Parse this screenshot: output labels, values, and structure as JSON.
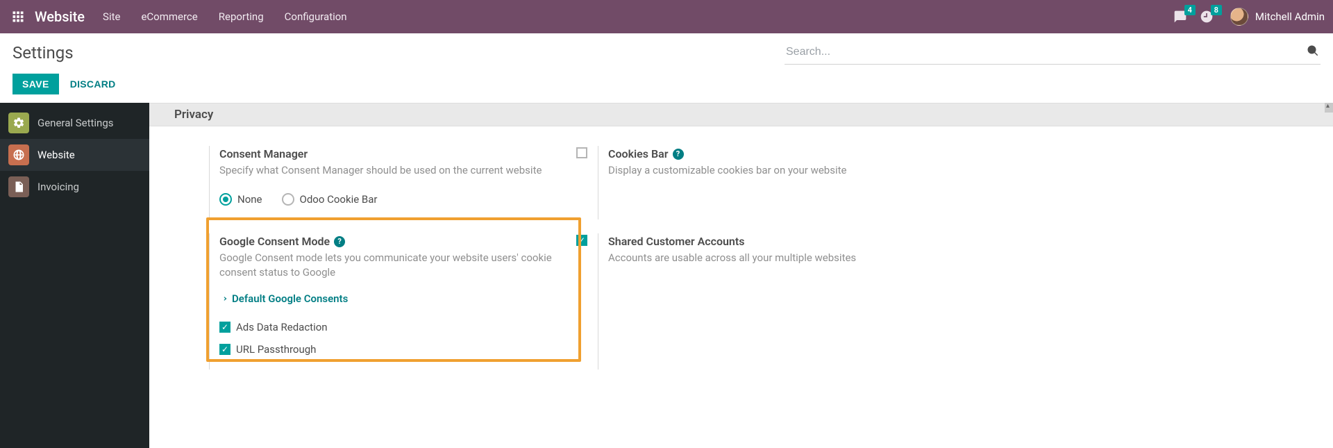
{
  "topbar": {
    "brand": "Website",
    "menu": [
      "Site",
      "eCommerce",
      "Reporting",
      "Configuration"
    ],
    "messages_badge": "4",
    "activities_badge": "8",
    "username": "Mitchell Admin"
  },
  "page": {
    "title": "Settings",
    "search_placeholder": "Search...",
    "save_label": "SAVE",
    "discard_label": "DISCARD"
  },
  "sidebar": {
    "items": [
      {
        "label": "General Settings"
      },
      {
        "label": "Website"
      },
      {
        "label": "Invoicing"
      }
    ],
    "active_index": 1
  },
  "section": {
    "title": "Privacy"
  },
  "settings": {
    "consent_manager": {
      "title": "Consent Manager",
      "desc": "Specify what Consent Manager should be used on the current website",
      "radios": {
        "none": "None",
        "odoo_cookie_bar": "Odoo Cookie Bar",
        "selected": "none"
      }
    },
    "cookies_bar": {
      "title": "Cookies Bar",
      "desc": "Display a customizable cookies bar on your website",
      "checked": false
    },
    "google_consent": {
      "title": "Google Consent Mode",
      "desc": "Google Consent mode lets you communicate your website users' cookie consent status to Google",
      "link_label": "Default Google Consents",
      "checks": {
        "ads_data_redaction": {
          "label": "Ads Data Redaction",
          "checked": true
        },
        "url_passthrough": {
          "label": "URL Passthrough",
          "checked": true
        }
      }
    },
    "shared_accounts": {
      "title": "Shared Customer Accounts",
      "desc": "Accounts are usable across all your multiple websites",
      "checked": true
    }
  }
}
